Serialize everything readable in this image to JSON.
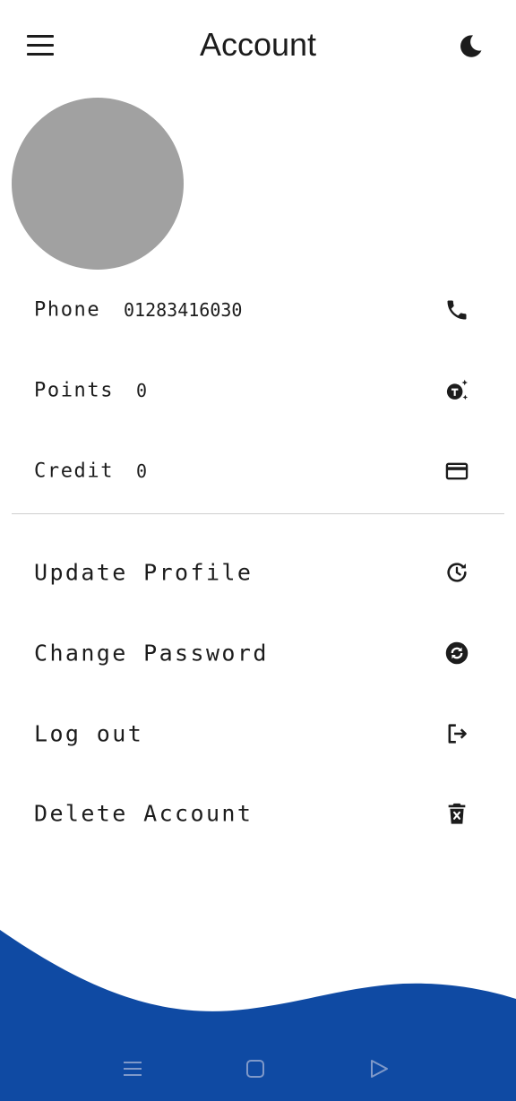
{
  "header": {
    "title": "Account",
    "menu_icon": "hamburger-menu-icon",
    "theme_icon": "moon-icon"
  },
  "profile": {
    "avatar_color": "#a1a1a1"
  },
  "info": [
    {
      "label": "Phone",
      "value": "01283416030",
      "icon": "phone-icon"
    },
    {
      "label": "Points",
      "value": "0",
      "icon": "points-sparkle-icon"
    },
    {
      "label": "Credit",
      "value": "0",
      "icon": "credit-card-icon"
    }
  ],
  "actions": [
    {
      "label": "Update Profile",
      "icon": "update-clock-icon"
    },
    {
      "label": "Change Password",
      "icon": "sync-circle-icon"
    },
    {
      "label": "Log out",
      "icon": "logout-icon"
    },
    {
      "label": "Delete Account",
      "icon": "trash-icon"
    }
  ],
  "colors": {
    "wave": "#0f4aa3",
    "text": "#1c1c1c",
    "divider": "#cfcfcf",
    "nav_icons": "#7f99c9"
  },
  "system_nav": [
    "recent-apps-icon",
    "home-icon",
    "back-icon"
  ]
}
